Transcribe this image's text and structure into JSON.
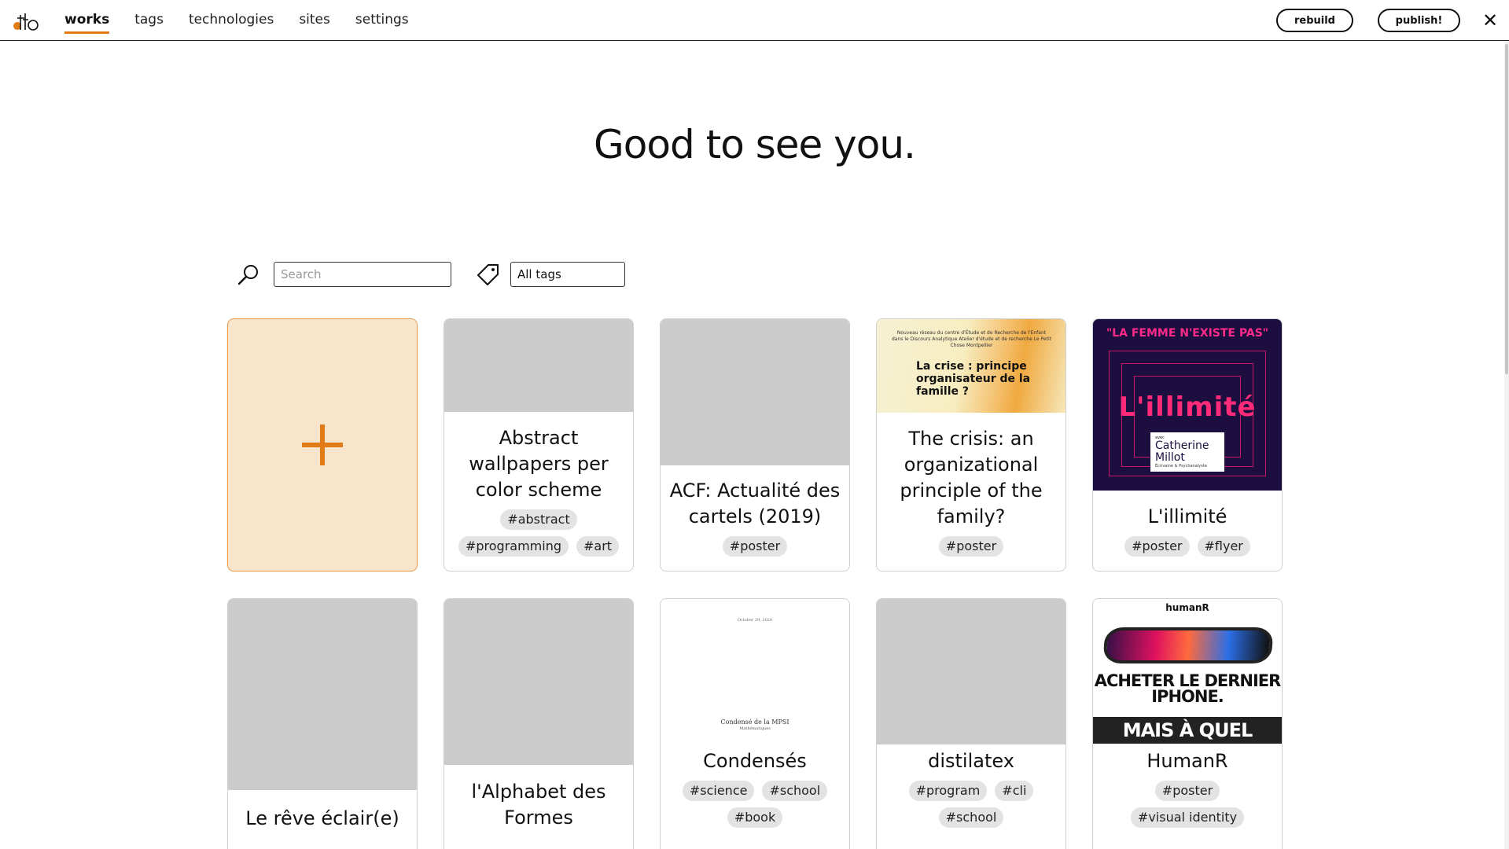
{
  "nav": {
    "items": [
      {
        "label": "works",
        "active": true
      },
      {
        "label": "tags"
      },
      {
        "label": "technologies"
      },
      {
        "label": "sites"
      },
      {
        "label": "settings"
      }
    ],
    "rebuild_label": "rebuild",
    "publish_label": "publish!",
    "close_glyph": "✕",
    "accent_color": "#e07b15"
  },
  "main": {
    "greeting": "Good to see you.",
    "search": {
      "placeholder": "Search",
      "value": ""
    },
    "tag_filter": {
      "selected": "All tags"
    },
    "add_card": {
      "glyph": "+",
      "background": "#f9e4cc"
    }
  },
  "works": [
    {
      "title": "Abstract wallpapers per color scheme",
      "tags": [
        "#abstract",
        "#programming",
        "#art"
      ]
    },
    {
      "title": "ACF: Actualité des cartels (2019)",
      "tags": [
        "#poster"
      ]
    },
    {
      "title": "The crisis: an organizational principle of the family?",
      "tags": [
        "#poster"
      ],
      "thumb_text": {
        "small": "Nouveau réseau du centre d'Étude et de Recherche de l'Enfant dans le Discours Analytique Atelier d'étude et de recherche Le Petit Chose Montpellier",
        "big": "La crise : principe organisateur de la famille ?"
      }
    },
    {
      "title": "L'illimité",
      "tags": [
        "#poster",
        "#flyer"
      ],
      "thumb_text": {
        "header": "\"LA FEMME N'EXISTE PAS\"",
        "word": "L'illimité",
        "avec": "avec",
        "name": "Catherine Millot",
        "role": "Écrivaine & Psychanalyste"
      }
    },
    {
      "title": "Le rêve éclair(e)",
      "tags": []
    },
    {
      "title": "l'Alphabet des Formes",
      "tags": []
    },
    {
      "title": "Condensés",
      "tags": [
        "#science",
        "#school",
        "#book"
      ],
      "thumb_text": {
        "date": "October 29, 2020",
        "title": "Condensé de la MPSI",
        "subtitle": "Mathématiques"
      }
    },
    {
      "title": "distilatex",
      "tags": [
        "#program",
        "#cli",
        "#school"
      ]
    },
    {
      "title": "HumanR",
      "tags": [
        "#poster",
        "#visual identity"
      ],
      "thumb_text": {
        "brand": "humanR",
        "line1": "ACHETER LE DERNIER IPHONE.",
        "line2": "MAIS À QUEL"
      }
    }
  ]
}
